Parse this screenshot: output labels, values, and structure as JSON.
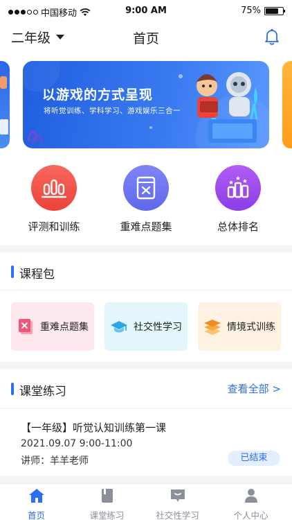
{
  "status_bar": {
    "carrier": "中国移动",
    "time": "9:00 AM",
    "battery": "75%",
    "battery_level": 0.75
  },
  "nav": {
    "grade": "二年级",
    "title": "首页"
  },
  "banner": {
    "title": "以游戏的方式呈现",
    "subtitle": "将听觉训练、学科学习、游戏娱乐三合一"
  },
  "features": [
    {
      "label": "评测和训练",
      "icon": "bar-chart-icon",
      "color": "#f2544a"
    },
    {
      "label": "重难点题集",
      "icon": "book-x-icon",
      "color": "#6a73f0"
    },
    {
      "label": "总体排名",
      "icon": "ranking-icon",
      "color": "#a04ef0"
    }
  ],
  "course_package": {
    "title": "课程包",
    "items": [
      {
        "label": "重难点题集",
        "icon": "book-x-icon",
        "bg": "#fde8ee"
      },
      {
        "label": "社交性学习",
        "icon": "graduation-cap-icon",
        "bg": "#e3f6fc"
      },
      {
        "label": "情境式训练",
        "icon": "layers-icon",
        "bg": "#fff2e2"
      }
    ]
  },
  "practice": {
    "title": "课堂练习",
    "view_all": "查看全部 >",
    "lesson": {
      "title": "【一年级】听觉认知训练第一课",
      "time": "2021.09.07  9:00-11:00",
      "teacher": "讲师：羊羊老师",
      "status": "已结束"
    }
  },
  "tabs": [
    {
      "label": "首页",
      "icon": "home-icon",
      "active": true
    },
    {
      "label": "课堂练习",
      "icon": "book-icon",
      "active": false
    },
    {
      "label": "社交性学习",
      "icon": "chat-icon",
      "active": false
    },
    {
      "label": "个人中心",
      "icon": "person-icon",
      "active": false
    }
  ],
  "colors": {
    "accent": "#2b6df6",
    "divider": "#f4f5f7"
  }
}
